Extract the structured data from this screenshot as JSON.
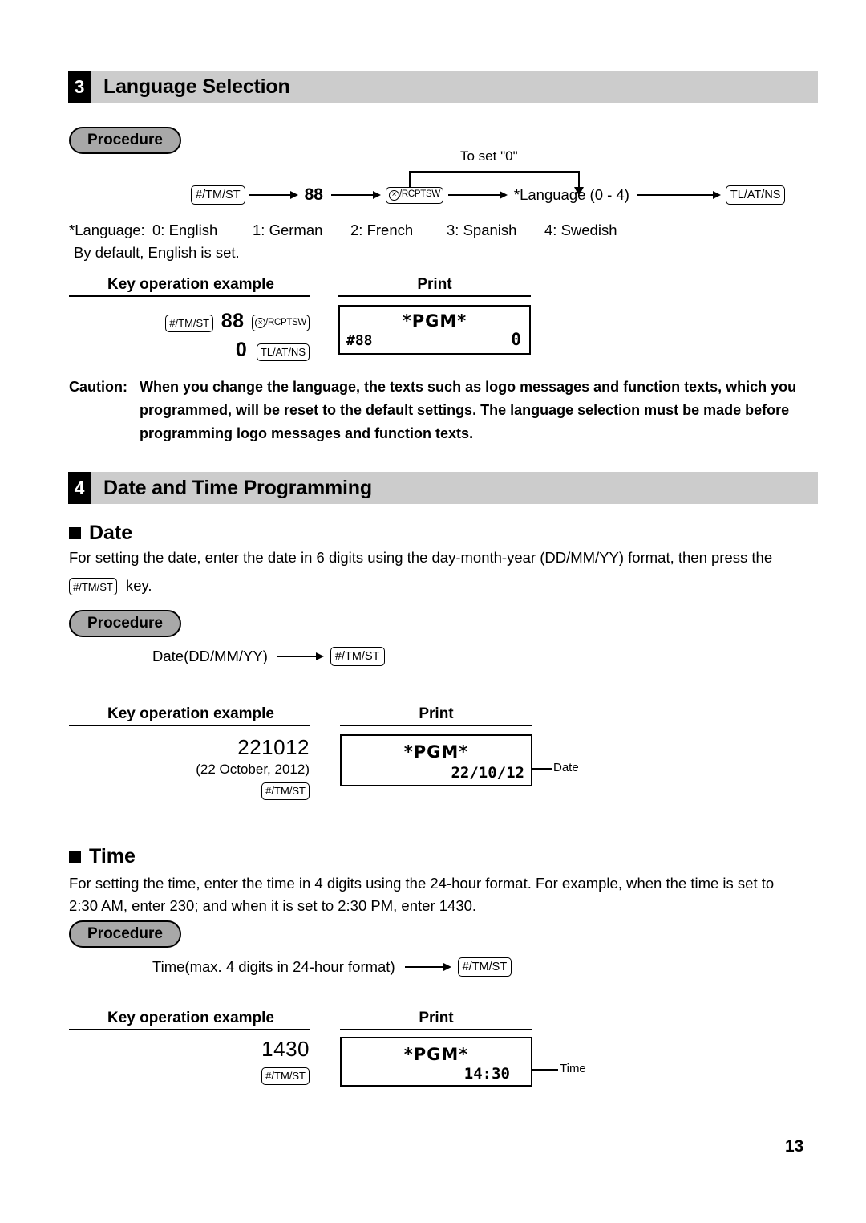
{
  "page": {
    "number": "13"
  },
  "sections": {
    "language": {
      "number": "3",
      "title": "Language Selection",
      "procedure_label": "Procedure",
      "flow": {
        "key1": "#/TM/ST",
        "value1": "88",
        "key2_symbol": "×",
        "key2": "/RCPTSW",
        "step_text": "*Language (0 - 4)",
        "bypass_label": "To set \"0\"",
        "key3": "TL/AT/NS"
      },
      "note_line1": "*Language: 0: English        1: German        2: French        3: Spanish        4: Swedish",
      "note_line1_parts": {
        "prefix": "*Language:",
        "opt0": "0: English",
        "opt1": "1: German",
        "opt2": "2: French",
        "opt3": "3: Spanish",
        "opt4": "4: Swedish"
      },
      "note_line2": "By default, English is set.",
      "col_key_title": "Key operation example",
      "col_print_title": "Print",
      "key_example": {
        "line1_key1": "#/TM/ST",
        "line1_value": "88",
        "line1_key2_symbol": "×",
        "line1_key2": "/RCPTSW",
        "line2_value": "0",
        "line2_key": "TL/AT/NS"
      },
      "receipt": {
        "title": "*PGM*",
        "left": "#88",
        "right": "0"
      },
      "caution": {
        "label": "Caution:",
        "line1": "When you change the language, the texts such as logo messages and function texts, which you",
        "line2": "programmed, will be reset to the default settings. The language selection must be made before",
        "line3": "programming logo messages and function texts."
      }
    },
    "datetime": {
      "number": "4",
      "title": "Date and Time Programming",
      "date": {
        "heading": "Date",
        "body_line1": "For setting the date, enter the date in 6 digits using the day-month-year (DD/MM/YY) format, then press the",
        "body_key": "#/TM/ST",
        "body_line2_tail": "key.",
        "procedure_label": "Procedure",
        "flow_text": "Date(DD/MM/YY)",
        "flow_key": "#/TM/ST",
        "col_key_title": "Key operation example",
        "col_print_title": "Print",
        "key_example": {
          "digits": "221012",
          "note": "(22 October, 2012)",
          "key": "#/TM/ST"
        },
        "receipt": {
          "title": "*PGM*",
          "value": "22/10/12",
          "callout": "Date"
        }
      },
      "time": {
        "heading": "Time",
        "body_line1": "For setting the time, enter the time in 4 digits using the 24-hour format.  For example, when the time is set to",
        "body_line2": "2:30 AM, enter 230; and when it is set to 2:30 PM, enter 1430.",
        "procedure_label": "Procedure",
        "flow_text": "Time(max. 4 digits in 24-hour format)",
        "flow_key": "#/TM/ST",
        "col_key_title": "Key operation example",
        "col_print_title": "Print",
        "key_example": {
          "digits": "1430",
          "key": "#/TM/ST"
        },
        "receipt": {
          "title": "*PGM*",
          "value": "14:30",
          "callout": "Time"
        }
      }
    }
  },
  "colors": {
    "header_bar": "#cccccc",
    "header_num_bg": "#000000",
    "procedure_pill": "#a8a8a8",
    "text": "#000000",
    "page_bg": "#ffffff"
  }
}
